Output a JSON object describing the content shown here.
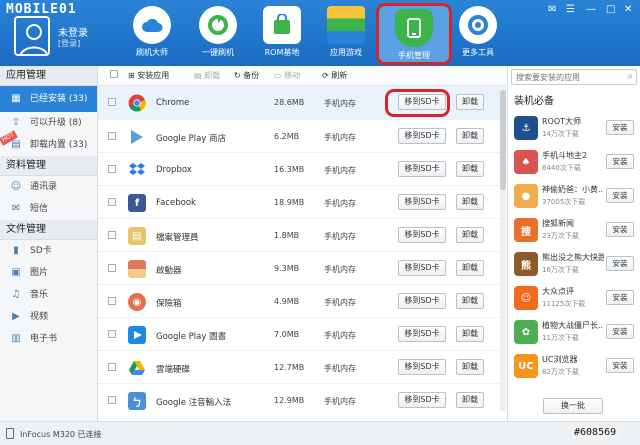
{
  "brand": {
    "logo": "MOBILE01"
  },
  "user": {
    "name": "未登录",
    "login": "[登录]"
  },
  "topnav": [
    {
      "label": "刷机大师",
      "icon": "cloud-icon"
    },
    {
      "label": "一键刷机",
      "icon": "refresh-circle-icon"
    },
    {
      "label": "ROM基地",
      "icon": "shopping-bag-icon"
    },
    {
      "label": "应用游戏",
      "icon": "app-grid-icon"
    },
    {
      "label": "手机管理",
      "icon": "phone-shield-icon"
    },
    {
      "label": "更多工具",
      "icon": "gear-wrench-icon"
    }
  ],
  "sidebar": {
    "app_manage": {
      "title": "应用管理",
      "items": [
        {
          "label": "已经安装 (33)"
        },
        {
          "label": "可以升级 (8)"
        },
        {
          "label": "卸载内置 (33)",
          "badge": "HOT"
        }
      ]
    },
    "data_manage": {
      "title": "资料管理",
      "items": [
        {
          "label": "通讯录"
        },
        {
          "label": "短信"
        }
      ]
    },
    "file_manage": {
      "title": "文件管理",
      "items": [
        {
          "label": "SD卡"
        },
        {
          "label": "图片"
        },
        {
          "label": "音乐"
        },
        {
          "label": "视频"
        },
        {
          "label": "电子书"
        }
      ]
    }
  },
  "toolbar": {
    "install": "安装应用",
    "uninstall": "卸载",
    "backup": "备份",
    "move": "移动",
    "refresh": "刷新"
  },
  "apps": [
    {
      "name": "Chrome",
      "size": "28.6MB",
      "location": "手机内存",
      "move": "移到SD卡",
      "uninstall": "卸载",
      "color": "#e8453c"
    },
    {
      "name": "Google Play 商店",
      "size": "6.2MB",
      "location": "手机内存",
      "move": "移到SD卡",
      "uninstall": "卸载",
      "color": "#5e9ed6"
    },
    {
      "name": "Dropbox",
      "size": "16.3MB",
      "location": "手机内存",
      "move": "移到SD卡",
      "uninstall": "卸载",
      "color": "#2b7fd6"
    },
    {
      "name": "Facebook",
      "size": "18.9MB",
      "location": "手机内存",
      "move": "移到SD卡",
      "uninstall": "卸载",
      "color": "#3b5998"
    },
    {
      "name": "檔案管理員",
      "size": "1.8MB",
      "location": "手机内存",
      "move": "移到SD卡",
      "uninstall": "卸载",
      "color": "#e9c46a"
    },
    {
      "name": "啟動器",
      "size": "9.3MB",
      "location": "手机内存",
      "move": "移到SD卡",
      "uninstall": "卸载",
      "color": "#e07a5f"
    },
    {
      "name": "保險箱",
      "size": "4.9MB",
      "location": "手机内存",
      "move": "移到SD卡",
      "uninstall": "卸载",
      "color": "#e76f51"
    },
    {
      "name": "Google Play 圖書",
      "size": "7.0MB",
      "location": "手机内存",
      "move": "移到SD卡",
      "uninstall": "卸载",
      "color": "#1e88e5"
    },
    {
      "name": "雲端硬碟",
      "size": "12.7MB",
      "location": "手机内存",
      "move": "移到SD卡",
      "uninstall": "卸载",
      "color": "#34a853"
    },
    {
      "name": "Google 注音輸入法",
      "size": "12.9MB",
      "location": "手机内存",
      "move": "移到SD卡",
      "uninstall": "卸载",
      "color": "#4a90d9"
    }
  ],
  "search": {
    "placeholder": "搜索要安装的应用"
  },
  "recommend": {
    "title": "装机必备",
    "refresh": "换一批",
    "items": [
      {
        "name": "ROOT大师",
        "downloads": "14万次下载",
        "button": "安装",
        "color": "#1f4e8c"
      },
      {
        "name": "手机斗地主2",
        "downloads": "6440次下载",
        "button": "安装",
        "color": "#d9534f"
      },
      {
        "name": "神偷奶爸：小黄...",
        "downloads": "37005次下载",
        "button": "安装",
        "color": "#f0ad4e"
      },
      {
        "name": "搜狐新闻",
        "downloads": "23万次下载",
        "button": "安装",
        "color": "#e8702a"
      },
      {
        "name": "熊出没之熊大快跑",
        "downloads": "16万次下载",
        "button": "安装",
        "color": "#8e5a2b"
      },
      {
        "name": "大众点评",
        "downloads": "11125次下载",
        "button": "安装",
        "color": "#f26a1b"
      },
      {
        "name": "植物大战僵尸长...",
        "downloads": "11万次下载",
        "button": "安装",
        "color": "#4caf50"
      },
      {
        "name": "UC浏览器",
        "downloads": "82万次下载",
        "button": "安装",
        "color": "#f7941d"
      }
    ]
  },
  "status": {
    "device": "InFocus M320 已连接",
    "watermark": "#608569"
  }
}
